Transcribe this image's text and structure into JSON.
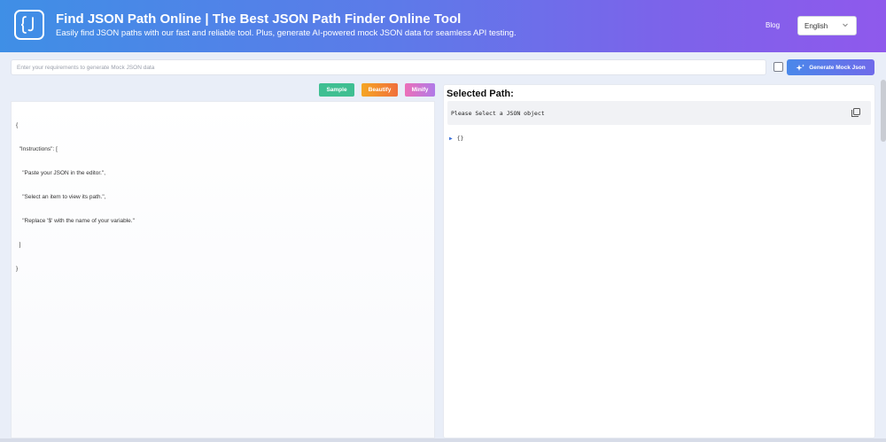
{
  "header": {
    "title": "Find JSON Path Online | The Best JSON Path Finder Online Tool",
    "subtitle": "Easily find JSON paths with our fast and reliable tool. Plus, generate AI-powered mock JSON data for seamless API testing.",
    "logo_icon": "json-braces-icon",
    "nav": {
      "blog_label": "Blog"
    },
    "language": {
      "selected": "English",
      "icon": "chevron-down-icon"
    }
  },
  "generator": {
    "placeholder": "Enter your requirements to generate Mock JSON data",
    "value": "",
    "checkbox_checked": false,
    "button_label": "Generate Mock Json",
    "button_icon": "sparkle-icon"
  },
  "toolbar": {
    "sample_label": "Sample",
    "beautify_label": "Beautify",
    "minify_label": "Minify"
  },
  "editor": {
    "lines": [
      "{",
      "  \"Instructions\": [",
      "    \"Paste your JSON in the editor.\",",
      "    \"Select an item to view its path.\",",
      "    \"Replace '$' with the name of your variable.\"",
      "  ]",
      "}"
    ]
  },
  "selected_path": {
    "title": "Selected Path:",
    "value": "Please Select a JSON object",
    "copy_icon": "copy-icon"
  },
  "tree": {
    "root_label": "{}",
    "expand_icon": "caret-right-icon"
  },
  "colors": {
    "header_gradient_start": "#3f8fe6",
    "header_gradient_end": "#8f59ec",
    "sample": "#3fbf92",
    "beautify": "#f5a623",
    "minify": "#ec6fb8"
  }
}
